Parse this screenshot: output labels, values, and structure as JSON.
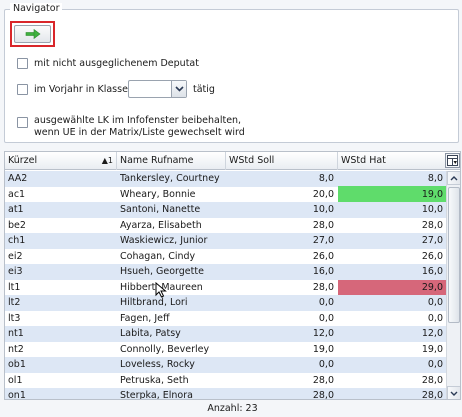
{
  "navigator": {
    "title": "Navigator",
    "go_button_icon": "arrow-right-icon",
    "options": {
      "deputat": "mit nicht ausgeglichenem Deputat",
      "vorjahr": "im Vorjahr in Klasse",
      "vorjahr_value": "",
      "vorjahr_suffix": "tätig",
      "keep_lk_line1": "ausgewählte LK im Infofenster beibehalten,",
      "keep_lk_line2": "wenn UE in der Matrix/Liste gewechselt wird"
    }
  },
  "grid": {
    "columns": {
      "kuerzel": "Kürzel",
      "sort_indicator": "▲1",
      "name": "Name Rufname",
      "soll": "WStd Soll",
      "hat": "WStd Hat"
    },
    "rows": [
      {
        "kuerzel": "AA2",
        "name": "Tankersley, Courtney",
        "soll": "8,0",
        "hat": "8,0",
        "status": "none"
      },
      {
        "kuerzel": "ac1",
        "name": "Wheary, Bonnie",
        "soll": "20,0",
        "hat": "19,0",
        "status": "green"
      },
      {
        "kuerzel": "at1",
        "name": "Santoni, Nanette",
        "soll": "10,0",
        "hat": "10,0",
        "status": "none"
      },
      {
        "kuerzel": "be2",
        "name": "Ayarza, Elisabeth",
        "soll": "28,0",
        "hat": "28,0",
        "status": "none"
      },
      {
        "kuerzel": "ch1",
        "name": "Waskiewicz, Junior",
        "soll": "27,0",
        "hat": "27,0",
        "status": "none"
      },
      {
        "kuerzel": "ei2",
        "name": "Cohagan, Cindy",
        "soll": "26,0",
        "hat": "26,0",
        "status": "none"
      },
      {
        "kuerzel": "ei3",
        "name": "Hsueh, Georgette",
        "soll": "16,0",
        "hat": "16,0",
        "status": "none"
      },
      {
        "kuerzel": "lt1",
        "name": "Hibbert, Maureen",
        "soll": "28,0",
        "hat": "29,0",
        "status": "red"
      },
      {
        "kuerzel": "lt2",
        "name": "Hiltbrand, Lori",
        "soll": "0,0",
        "hat": "0,0",
        "status": "none"
      },
      {
        "kuerzel": "lt3",
        "name": "Fagen, Jeff",
        "soll": "0,0",
        "hat": "0,0",
        "status": "none"
      },
      {
        "kuerzel": "nt1",
        "name": "Labita, Patsy",
        "soll": "12,0",
        "hat": "12,0",
        "status": "none"
      },
      {
        "kuerzel": "nt2",
        "name": "Connolly, Beverley",
        "soll": "19,0",
        "hat": "19,0",
        "status": "none"
      },
      {
        "kuerzel": "ob1",
        "name": "Loveless, Rocky",
        "soll": "0,0",
        "hat": "0,0",
        "status": "none"
      },
      {
        "kuerzel": "ol1",
        "name": "Petruska, Seth",
        "soll": "28,0",
        "hat": "28,0",
        "status": "none"
      },
      {
        "kuerzel": "on1",
        "name": "Sterpka, Elnora",
        "soll": "28,0",
        "hat": "28,0",
        "status": "none"
      }
    ]
  },
  "footer": {
    "count_text": "Anzahl: 23"
  },
  "colors": {
    "green": "#5fdc6b",
    "red": "#d6677a",
    "alt_row": "#dde7f5",
    "highlight_frame": "#d9262a"
  }
}
